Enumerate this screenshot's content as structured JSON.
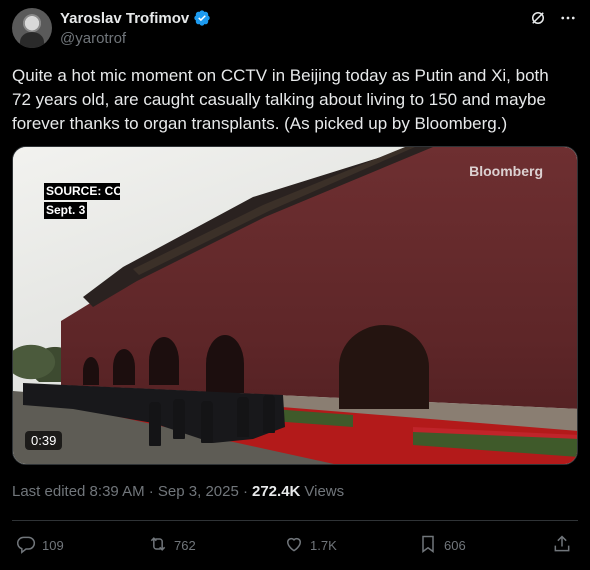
{
  "author": {
    "display_name": "Yaroslav Trofimov",
    "handle": "@yarotrof",
    "verified_icon": "verified-badge-icon"
  },
  "tweet": {
    "text": "Quite a hot mic moment on CCTV in Beijing today as Putin and Xi, both 72 years old, are caught casually talking about living to 150 and maybe forever thanks to organ transplants. (As picked up by Bloomberg.)"
  },
  "media": {
    "caption_line1": "SOURCE: CC",
    "caption_line2": "Sept. 3",
    "brand": "Bloomberg",
    "duration": "0:39"
  },
  "meta": {
    "edited": "Last edited 8:39 AM · Sep 3, 2025 ·",
    "views_count": "272.4K",
    "views_label": "Views"
  },
  "actions": {
    "replies": "109",
    "reposts": "762",
    "likes": "1.7K",
    "bookmarks": "606"
  },
  "colors": {
    "background": "#000000",
    "text": "#e7e9ea",
    "muted": "#71767b",
    "verified": "#1d9bf0"
  }
}
